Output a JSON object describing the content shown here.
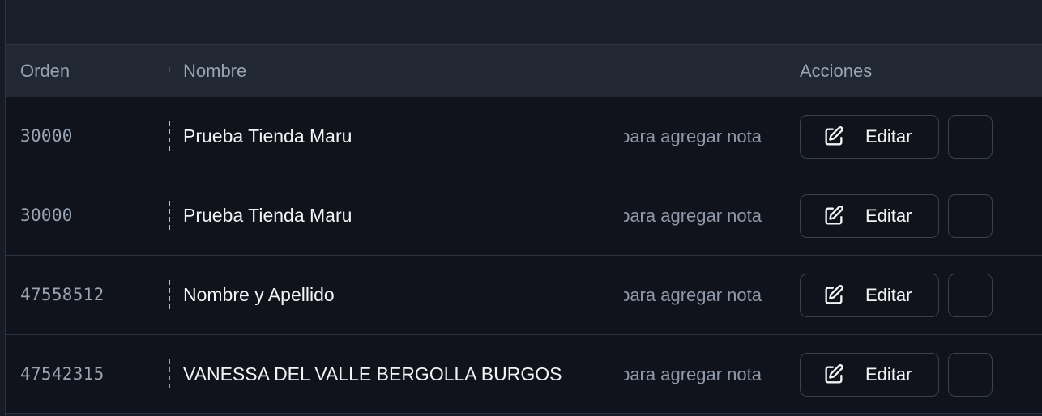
{
  "table": {
    "headers": {
      "order": "Orden",
      "name": "Nombre",
      "actions": "Acciones"
    },
    "rows": [
      {
        "order": "30000",
        "name": "Prueba Tienda Maru",
        "note": "Click para agregar nota",
        "edit_label": "Editar",
        "handle_status": "normal"
      },
      {
        "order": "30000",
        "name": "Prueba Tienda Maru",
        "note": "Click para agregar nota",
        "edit_label": "Editar",
        "handle_status": "normal"
      },
      {
        "order": "47558512",
        "name": "Nombre y Apellido",
        "note": "Click para agregar nota",
        "edit_label": "Editar",
        "handle_status": "normal"
      },
      {
        "order": "47542315",
        "name": "VANESSA DEL VALLE BERGOLLA BURGOS",
        "note": "Click para agregar nota",
        "edit_label": "Editar",
        "handle_status": "warning"
      }
    ]
  },
  "icons": {
    "edit": "pencil-square-icon",
    "drag": "drag-handle-icon"
  },
  "colors": {
    "background": "#10131b",
    "header_background": "#212733",
    "warning_handle": "#f5a13b"
  }
}
